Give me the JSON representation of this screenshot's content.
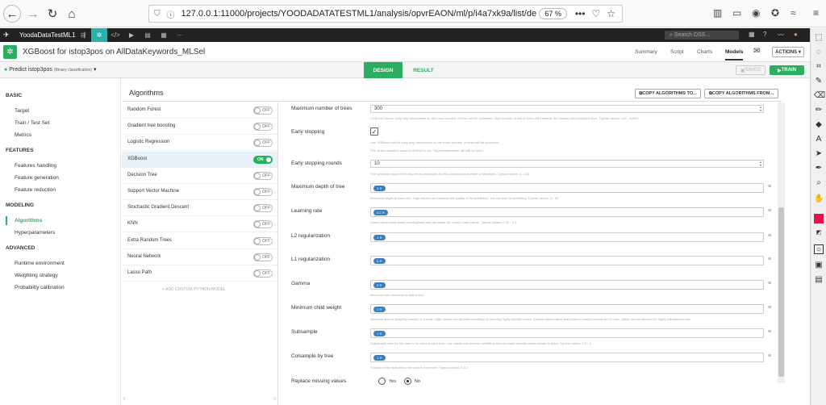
{
  "browser": {
    "url": "127.0.0.1:11000/projects/YOODADATATESTML1/analysis/opvrEAON/ml/p/i4a7xk9a/list/de",
    "zoom": "67 %",
    "more_icon": "•••"
  },
  "dss": {
    "project_name": "YoodaDataTestML1",
    "search_placeholder": "Search DSS..."
  },
  "model": {
    "title": "XGBoost for istop3pos on AllDataKeywords_MLSel",
    "tabs": [
      "Summary",
      "Script",
      "Charts",
      "Models"
    ],
    "actions_label": "ACTIONS"
  },
  "subheader": {
    "predict": "Predict istop3pos",
    "predict_type": "(Binary classification)",
    "design_tab": "DESIGN",
    "result_tab": "RESULT",
    "saved": "SAVED",
    "train": "TRAIN"
  },
  "sidebar": {
    "basic": "BASIC",
    "target": "Target",
    "train_test": "Train / Test Set",
    "metrics": "Metrics",
    "features": "FEATURES",
    "features_handling": "Features handling",
    "feature_generation": "Feature generation",
    "feature_reduction": "Feature reduction",
    "modeling": "MODELING",
    "algorithms": "Algorithms",
    "hyperparameters": "Hyperparameters",
    "advanced": "ADVANCED",
    "runtime": "Runtime environment",
    "weighting": "Weighting strategy",
    "calibration": "Probability calibration"
  },
  "algorithms": {
    "title": "Algorithms",
    "copy_to": "COPY ALGORITHMS TO...",
    "copy_from": "COPY ALGORITHMS FROM...",
    "on_label": "ON",
    "off_label": "OFF",
    "add_custom": "+ ADD CUSTOM PYTHON MODEL",
    "list": [
      {
        "name": "Random Forest",
        "on": false
      },
      {
        "name": "Gradient tree boosting",
        "on": false
      },
      {
        "name": "Logistic Regression",
        "on": false
      },
      {
        "name": "XGBoost",
        "on": true
      },
      {
        "name": "Decision Tree",
        "on": false
      },
      {
        "name": "Support Vector Machine",
        "on": false
      },
      {
        "name": "Stochastic Gradient Descent",
        "on": false
      },
      {
        "name": "KNN",
        "on": false
      },
      {
        "name": "Extra Random Trees",
        "on": false
      },
      {
        "name": "Neural Network",
        "on": false
      },
      {
        "name": "Lasso Path",
        "on": false
      }
    ]
  },
  "params": {
    "max_trees": {
      "label": "Maximum number of trees",
      "value": "300",
      "help": "XGBoost has an early stop mechanism so the exact number of trees will be optimized. High number of actual trees will increase the training and prediction time. Typical values: 100 - 10000"
    },
    "early_stop": {
      "label": "Early stopping",
      "checked": "✓",
      "help1": "Use XGBoost built-in early stop mechanism so the exact number of trees will be optimized.",
      "help2": "The cross-validation scheme defined in the \"Hyperparameters\" tab will be used."
    },
    "early_rounds": {
      "label": "Early stopping rounds",
      "value": "10",
      "help": "The optimizer stops if the loss never decreases for this consecutive number of iterations. Typical values: 1 - 100"
    },
    "max_depth": {
      "label": "Maximum depth of tree",
      "chip": "3",
      "help": "Maximum depth of each tree. High values can increase the quality of the prediction, but can lead to overfitting. Typical values: 3 - 10"
    },
    "learning_rate": {
      "label": "Learning rate",
      "chip": "0.2",
      "help": "Lower values slow down convergence and can make the model more robust. Typical values: 0.01 - 0.3"
    },
    "l2": {
      "label": "L2 regularization",
      "chip": "1"
    },
    "l1": {
      "label": "L1 regularization",
      "chip": "0"
    },
    "gamma": {
      "label": "Gamma",
      "chip": "0",
      "help": "Minimum loss reduction to split a leaf."
    },
    "min_child": {
      "label": "Minimum child weight",
      "chip": "1",
      "help": "Minimum sum of weights(hessian) in a node. High values can prevent overfitting by learning highly specific cases. Smaller values allow leaf nodes to match a small set of rows, which can be relevant for highly imbalanced sets."
    },
    "subsample": {
      "label": "Subsample",
      "chip": "1",
      "help": "Subsample ratio for the data to be used in each tree. Low values can prevent overfitting but can make specific cases harder to learn. Typical values: 0.5 - 1"
    },
    "colsample": {
      "label": "Colsample by tree",
      "chip": "1",
      "help": "Fraction of the features to be used in each tree. Typical values: 0.5-1"
    },
    "replace_missing": {
      "label": "Replace missing values",
      "yes": "Yes",
      "no": "No"
    }
  }
}
